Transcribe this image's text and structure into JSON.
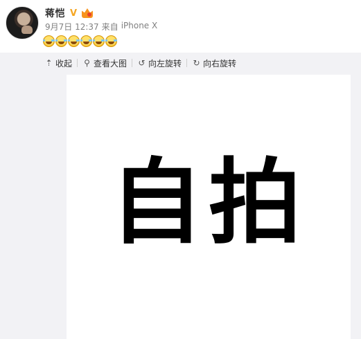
{
  "post": {
    "username": "蒋恺",
    "verified_icon": "verified-v-icon",
    "member_icon": "vip-member-icon",
    "date": "9月7日 12:37",
    "source_prefix": "来自",
    "source": "iPhone X",
    "emojis": [
      "laugh-cry-emoji",
      "laugh-cry-emoji",
      "laugh-cry-emoji",
      "laugh-cry-emoji",
      "laugh-cry-emoji",
      "laugh-cry-emoji"
    ]
  },
  "toolbar": {
    "collapse_label": "收起",
    "view_large_label": "查看大图",
    "rotate_left_label": "向左旋转",
    "rotate_right_label": "向右旋转"
  },
  "photo": {
    "text": "自拍"
  },
  "colors": {
    "verified": "#f5a623",
    "meta_text": "#808080",
    "panel_bg": "#f2f2f5"
  }
}
